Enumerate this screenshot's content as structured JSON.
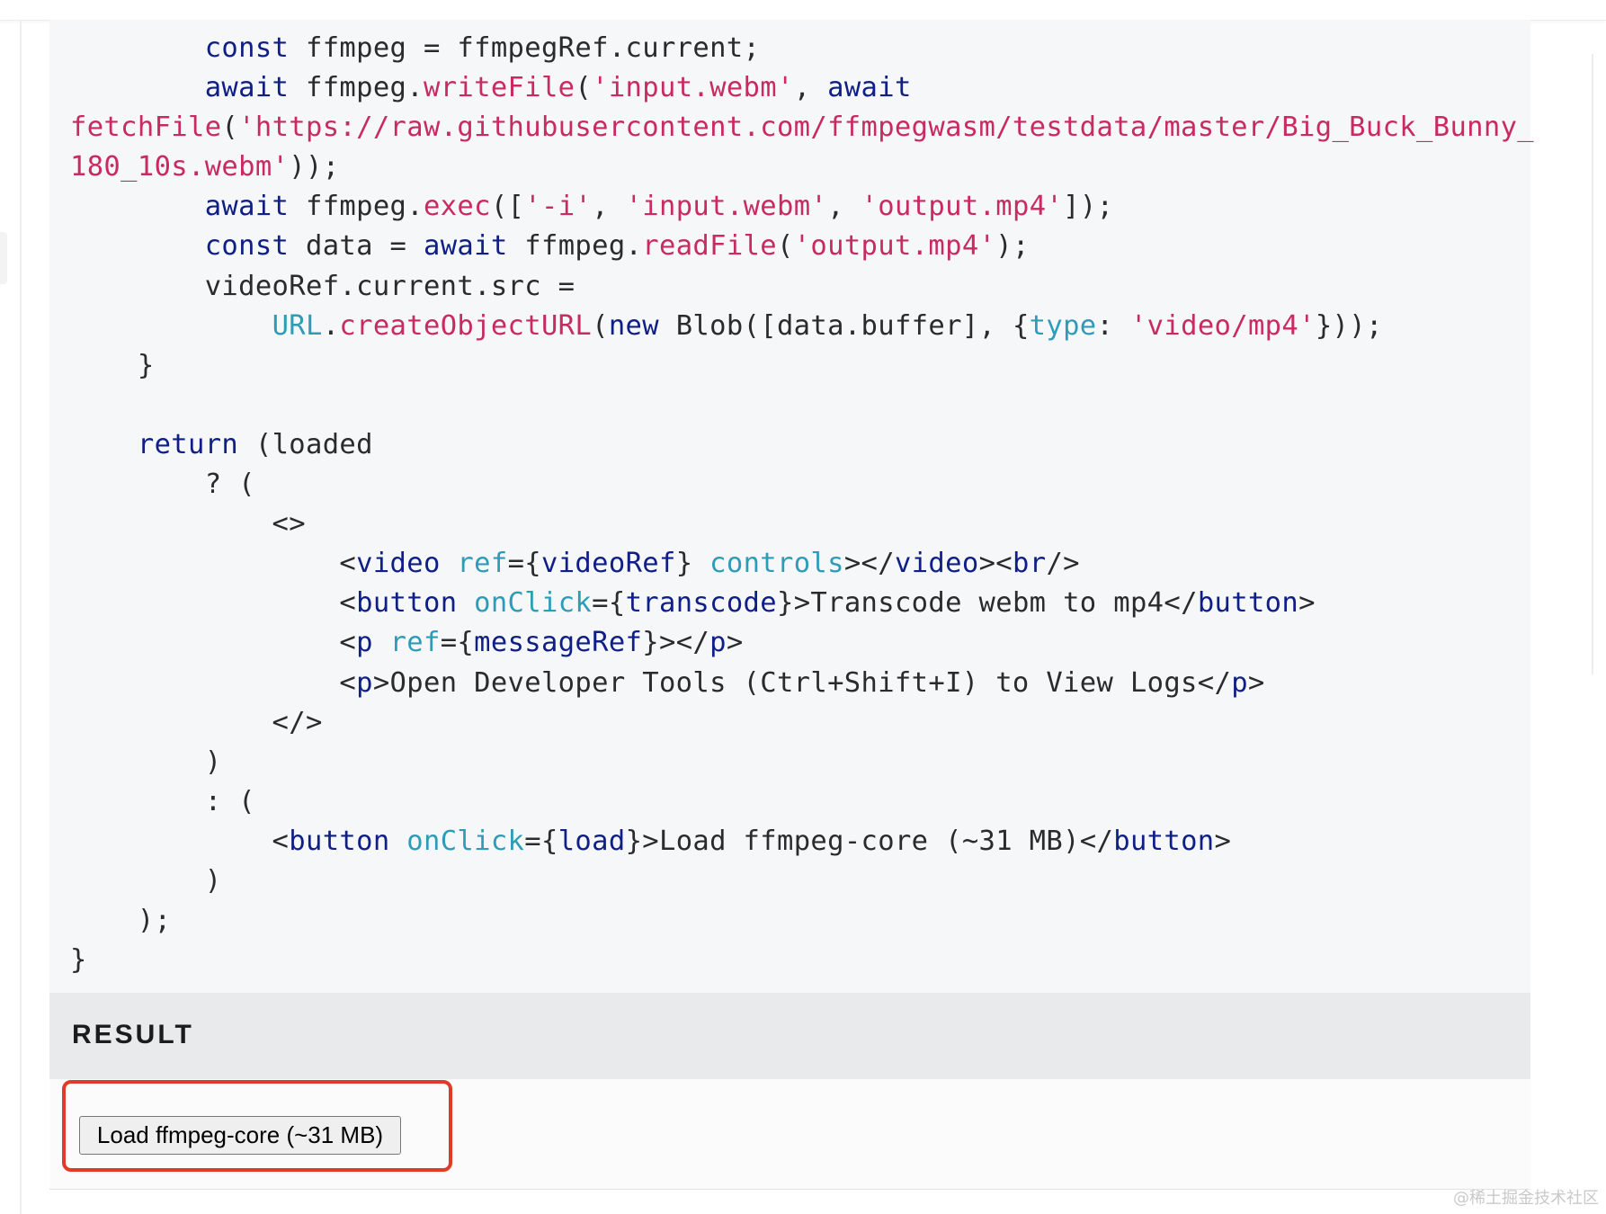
{
  "code_lines": [
    {
      "text": [
        "        ",
        {
          "k": "kw",
          "t": "const"
        },
        " ffmpeg = ffmpegRef.current;"
      ]
    },
    {
      "text": [
        "        ",
        {
          "k": "kw",
          "t": "await"
        },
        " ffmpeg.",
        {
          "k": "fn",
          "t": "writeFile"
        },
        "(",
        {
          "k": "str",
          "t": "'input.webm'"
        },
        ", ",
        {
          "k": "kw",
          "t": "await"
        }
      ]
    },
    {
      "text": [
        {
          "k": "fn",
          "t": "fetchFile"
        },
        "(",
        {
          "k": "str",
          "t": "'https://raw.githubusercontent.com/ffmpegwasm/testdata/master/Big_Buck_Bunny_"
        }
      ]
    },
    {
      "text": [
        {
          "k": "str",
          "t": "180_10s.webm'"
        },
        "));"
      ]
    },
    {
      "text": [
        "        ",
        {
          "k": "kw",
          "t": "await"
        },
        " ffmpeg.",
        {
          "k": "fn",
          "t": "exec"
        },
        "([",
        {
          "k": "str",
          "t": "'-i'"
        },
        ", ",
        {
          "k": "str",
          "t": "'input.webm'"
        },
        ", ",
        {
          "k": "str",
          "t": "'output.mp4'"
        },
        "]);"
      ]
    },
    {
      "text": [
        "        ",
        {
          "k": "kw",
          "t": "const"
        },
        " data = ",
        {
          "k": "kw",
          "t": "await"
        },
        " ffmpeg.",
        {
          "k": "fn",
          "t": "readFile"
        },
        "(",
        {
          "k": "str",
          "t": "'output.mp4'"
        },
        ");"
      ]
    },
    {
      "text": [
        "        videoRef.current.src ="
      ]
    },
    {
      "text": [
        "            ",
        {
          "k": "attr",
          "t": "URL"
        },
        ".",
        {
          "k": "fn",
          "t": "createObjectURL"
        },
        "(",
        {
          "k": "kw",
          "t": "new"
        },
        " Blob([data.buffer], {",
        {
          "k": "attr",
          "t": "type"
        },
        ": ",
        {
          "k": "str",
          "t": "'video/mp4'"
        },
        "}));"
      ]
    },
    {
      "text": [
        "    }"
      ]
    },
    {
      "text": [
        ""
      ]
    },
    {
      "text": [
        "    ",
        {
          "k": "kw",
          "t": "return"
        },
        " (loaded"
      ]
    },
    {
      "text": [
        "        ? ("
      ]
    },
    {
      "text": [
        "            <>"
      ]
    },
    {
      "text": [
        "                <",
        {
          "k": "tag",
          "t": "video"
        },
        " ",
        {
          "k": "attr",
          "t": "ref"
        },
        "={",
        {
          "k": "tag",
          "t": "videoRef"
        },
        "} ",
        {
          "k": "attr",
          "t": "controls"
        },
        "></",
        {
          "k": "tag",
          "t": "video"
        },
        "><",
        {
          "k": "tag",
          "t": "br"
        },
        "/>"
      ]
    },
    {
      "text": [
        "                <",
        {
          "k": "tag",
          "t": "button"
        },
        " ",
        {
          "k": "attr",
          "t": "onClick"
        },
        "={",
        {
          "k": "tag",
          "t": "transcode"
        },
        "}>Transcode webm to mp4</",
        {
          "k": "tag",
          "t": "button"
        },
        ">"
      ]
    },
    {
      "text": [
        "                <",
        {
          "k": "tag",
          "t": "p"
        },
        " ",
        {
          "k": "attr",
          "t": "ref"
        },
        "={",
        {
          "k": "tag",
          "t": "messageRef"
        },
        "}></",
        {
          "k": "tag",
          "t": "p"
        },
        ">"
      ]
    },
    {
      "text": [
        "                <",
        {
          "k": "tag",
          "t": "p"
        },
        ">Open Developer Tools (Ctrl+Shift+I) to View Logs</",
        {
          "k": "tag",
          "t": "p"
        },
        ">"
      ]
    },
    {
      "text": [
        "            </>"
      ]
    },
    {
      "text": [
        "        )"
      ]
    },
    {
      "text": [
        "        : ("
      ]
    },
    {
      "text": [
        "            <",
        {
          "k": "tag",
          "t": "button"
        },
        " ",
        {
          "k": "attr",
          "t": "onClick"
        },
        "={",
        {
          "k": "tag",
          "t": "load"
        },
        "}>Load ffmpeg-core (~31 MB)</",
        {
          "k": "tag",
          "t": "button"
        },
        ">"
      ]
    },
    {
      "text": [
        "        )"
      ]
    },
    {
      "text": [
        "    );"
      ]
    },
    {
      "text": [
        "}"
      ]
    }
  ],
  "result": {
    "title": "RESULT",
    "button_label": "Load ffmpeg-core (~31 MB)"
  },
  "watermark": "@稀土掘金技术社区",
  "colors": {
    "keyword": "#0f1f85",
    "string": "#c82b60",
    "attribute": "#2f9cb7",
    "highlight_border": "#e03b2a"
  }
}
